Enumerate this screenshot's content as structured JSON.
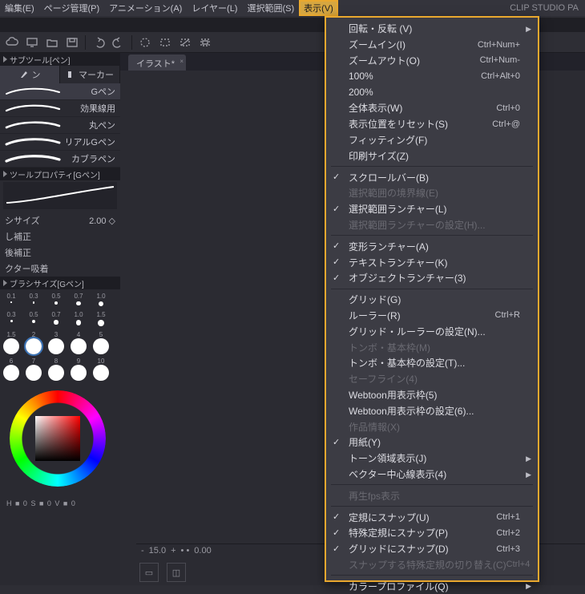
{
  "app_title": "CLIP STUDIO PA",
  "menubar": [
    "編集(E)",
    "ページ管理(P)",
    "アニメーション(A)",
    "レイヤー(L)",
    "選択範囲(S)",
    "表示(V)"
  ],
  "menubar_selected_index": 5,
  "tab_label": "イラスト*",
  "subtool_panel_title": "サブツール[ペン]",
  "tool_tabs": {
    "pen": "ン",
    "marker": "マーカー"
  },
  "brush_rows": [
    "Gペン",
    "効果線用",
    "丸ペン",
    "リアルGペン",
    "カブラペン"
  ],
  "toolprop_title": "ツールプロパティ[Gペン]",
  "prop_lines": [
    {
      "label": "シサイズ",
      "value": "2.00 ◇"
    },
    {
      "label": "し補正",
      "value": ""
    },
    {
      "label": "後補正",
      "value": ""
    },
    {
      "label": "クター吸着",
      "value": ""
    }
  ],
  "brushsize_title": "ブラシサイズ[Gペン]",
  "size_labels_row1": [
    "0.1",
    "0.3",
    "0.5",
    "0.7",
    "1.0"
  ],
  "size_labels_row2": [
    "0.3",
    "0.5",
    "0.7",
    "1.0",
    "1.5"
  ],
  "chip_row1_sizes": [
    12,
    14,
    16,
    18,
    20
  ],
  "chip_row1": [
    "1.5",
    "2",
    "3",
    "4",
    "5"
  ],
  "chip_row2": [
    "6",
    "7",
    "8",
    "9",
    "10"
  ],
  "hsv_readout": "H ■ 0  S ■ 0  V ■ 0",
  "ruler": {
    "neg": "-",
    "val": "15.0",
    "plus": "+",
    "dot": "•  •",
    "zero": "0.00"
  },
  "menu": [
    {
      "label": "回転・反転 (V)",
      "arrow": true
    },
    {
      "label": "ズームイン(I)",
      "acc": "Ctrl+Num+"
    },
    {
      "label": "ズームアウト(O)",
      "acc": "Ctrl+Num-"
    },
    {
      "label": "100%",
      "acc": "Ctrl+Alt+0"
    },
    {
      "label": "200%"
    },
    {
      "label": "全体表示(W)",
      "acc": "Ctrl+0"
    },
    {
      "label": "表示位置をリセット(S)",
      "acc": "Ctrl+@"
    },
    {
      "label": "フィッティング(F)"
    },
    {
      "label": "印刷サイズ(Z)"
    },
    {
      "sep": true
    },
    {
      "label": "スクロールバー(B)",
      "checked": true
    },
    {
      "label": "選択範囲の境界線(E)",
      "disabled": true
    },
    {
      "label": "選択範囲ランチャー(L)",
      "checked": true
    },
    {
      "label": "選択範囲ランチャーの設定(H)...",
      "disabled": true
    },
    {
      "sep": true
    },
    {
      "label": "変形ランチャー(A)",
      "checked": true
    },
    {
      "label": "テキストランチャー(K)",
      "checked": true
    },
    {
      "label": "オブジェクトランチャー(3)",
      "checked": true
    },
    {
      "sep": true
    },
    {
      "label": "グリッド(G)"
    },
    {
      "label": "ルーラー(R)",
      "acc": "Ctrl+R"
    },
    {
      "label": "グリッド・ルーラーの設定(N)..."
    },
    {
      "label": "トンボ・基本枠(M)",
      "disabled": true
    },
    {
      "label": "トンボ・基本枠の設定(T)..."
    },
    {
      "label": "セーフライン(4)",
      "disabled": true
    },
    {
      "label": "Webtoon用表示枠(5)"
    },
    {
      "label": "Webtoon用表示枠の設定(6)..."
    },
    {
      "label": "作品情報(X)",
      "disabled": true
    },
    {
      "label": "用紙(Y)",
      "checked": true
    },
    {
      "label": "トーン領域表示(J)",
      "arrow": true
    },
    {
      "label": "ベクター中心線表示(4)",
      "arrow": true
    },
    {
      "sep": true
    },
    {
      "label": "再生fps表示",
      "disabled": true
    },
    {
      "sep": true
    },
    {
      "label": "定規にスナップ(U)",
      "checked": true,
      "acc": "Ctrl+1"
    },
    {
      "label": "特殊定規にスナップ(P)",
      "checked": true,
      "acc": "Ctrl+2"
    },
    {
      "label": "グリッドにスナップ(D)",
      "checked": true,
      "acc": "Ctrl+3"
    },
    {
      "label": "スナップする特殊定規の切り替え(C)",
      "disabled": true,
      "acc": "Ctrl+4"
    },
    {
      "sep": true
    },
    {
      "label": "カラープロファイル(Q)",
      "arrow": true
    }
  ]
}
